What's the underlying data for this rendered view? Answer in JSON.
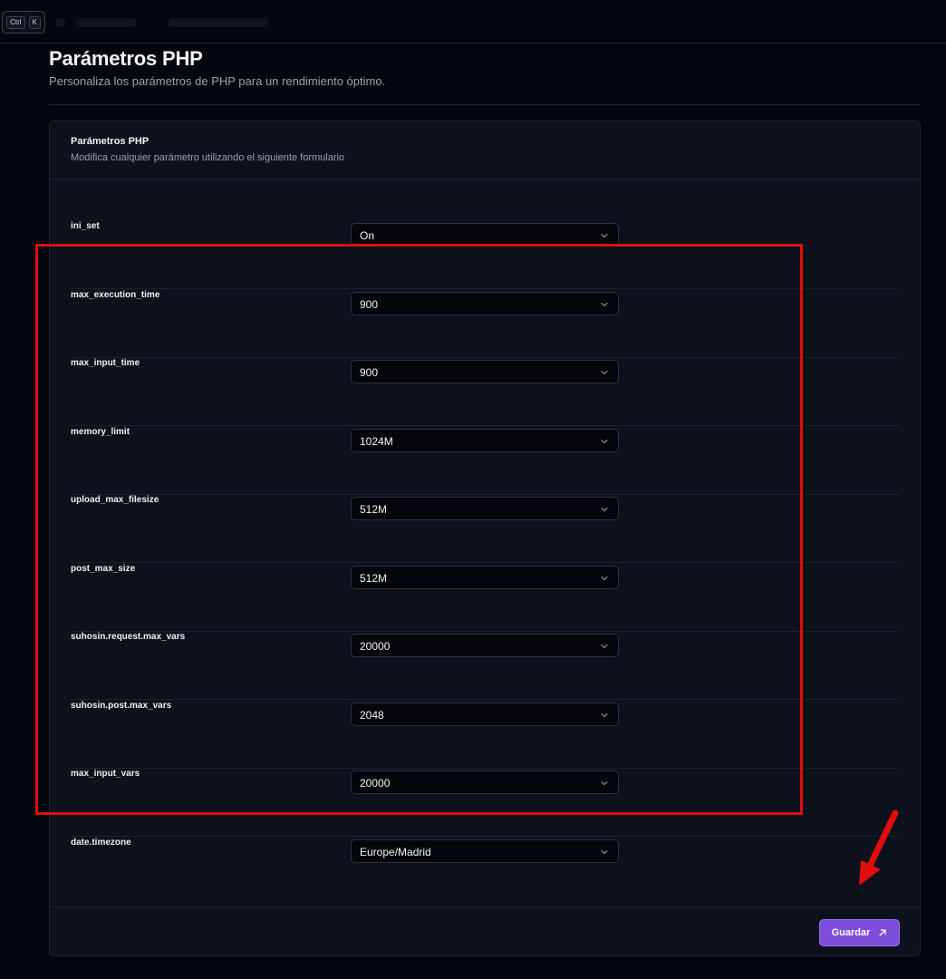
{
  "topbar": {
    "shortcut_ctrl": "Ctrl",
    "shortcut_k": "K"
  },
  "page": {
    "title": "Parámetros PHP",
    "subtitle": "Personaliza los parámetros de PHP para un rendimiento óptimo."
  },
  "card": {
    "title": "Parámetros PHP",
    "description": "Modifica cualquier parámetro utilizando el siguiente formulario"
  },
  "params": [
    {
      "label": "ini_set",
      "value": "On"
    },
    {
      "label": "max_execution_time",
      "value": "900"
    },
    {
      "label": "max_input_time",
      "value": "900"
    },
    {
      "label": "memory_limit",
      "value": "1024M"
    },
    {
      "label": "upload_max_filesize",
      "value": "512M"
    },
    {
      "label": "post_max_size",
      "value": "512M"
    },
    {
      "label": "suhosin.request.max_vars",
      "value": "20000"
    },
    {
      "label": "suhosin.post.max_vars",
      "value": "2048"
    },
    {
      "label": "max_input_vars",
      "value": "20000"
    },
    {
      "label": "date.timezone",
      "value": "Europe/Madrid"
    }
  ],
  "footer": {
    "save_label": "Guardar",
    "save_icon": "arrow-up-right-icon"
  },
  "annotations": {
    "highlight_color": "#e10d0d"
  },
  "colors": {
    "accent": "#7c4ddb",
    "background": "#05070f",
    "card": "#0c111b"
  }
}
